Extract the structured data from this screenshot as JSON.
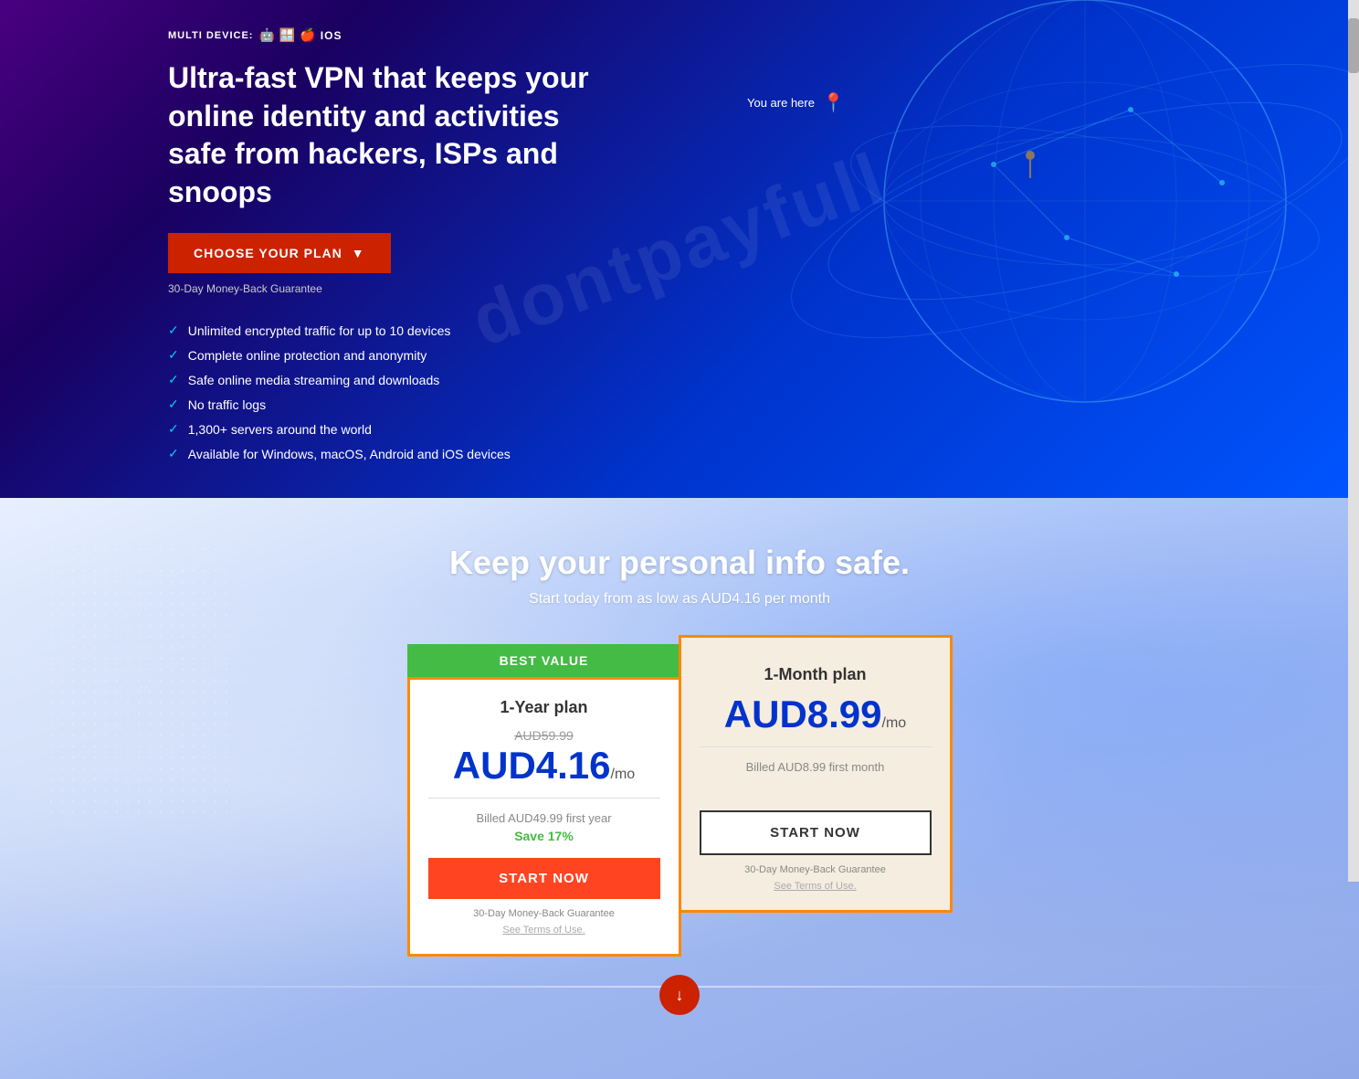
{
  "hero": {
    "multi_device_label": "MULTI DEVICE:",
    "device_icons": [
      "android",
      "windows",
      "mac",
      "ios"
    ],
    "ios_label": "iOS",
    "title": "Ultra-fast VPN that keeps your online identity and activities safe from hackers, ISPs and snoops",
    "choose_plan_btn": "CHOOSE YOUR PLAN",
    "money_back": "30-Day Money-Back Guarantee",
    "features": [
      "Unlimited encrypted traffic for up to 10 devices",
      "Complete online protection and anonymity",
      "Safe online media streaming and downloads",
      "No traffic logs",
      "1,300+ servers around the world",
      "Available for Windows, macOS, Android and iOS devices"
    ],
    "you_are_here": "You are here",
    "watermark": "dontpayfull"
  },
  "pricing": {
    "title": "Keep your personal info safe.",
    "subtitle": "Start today from as low as AUD4.16 per month",
    "plans": [
      {
        "badge": "BEST VALUE",
        "name": "1-Year plan",
        "original_price": "AUD59.99",
        "price_main": "AUD4.16",
        "price_suffix": "/mo",
        "billing": "Billed AUD49.99 first year",
        "save": "Save 17%",
        "btn_label": "START NOW",
        "guarantee": "30-Day Money-Back Guarantee",
        "terms": "See Terms of Use."
      },
      {
        "badge": "",
        "name": "1-Month plan",
        "original_price": "",
        "price_main": "AUD8.99",
        "price_suffix": "/mo",
        "billing": "Billed AUD8.99 first month",
        "save": "",
        "btn_label": "START NOW",
        "guarantee": "30-Day Money-Back Guarantee",
        "terms": "See Terms of Use."
      }
    ],
    "bottom_btn_label": "↓"
  }
}
